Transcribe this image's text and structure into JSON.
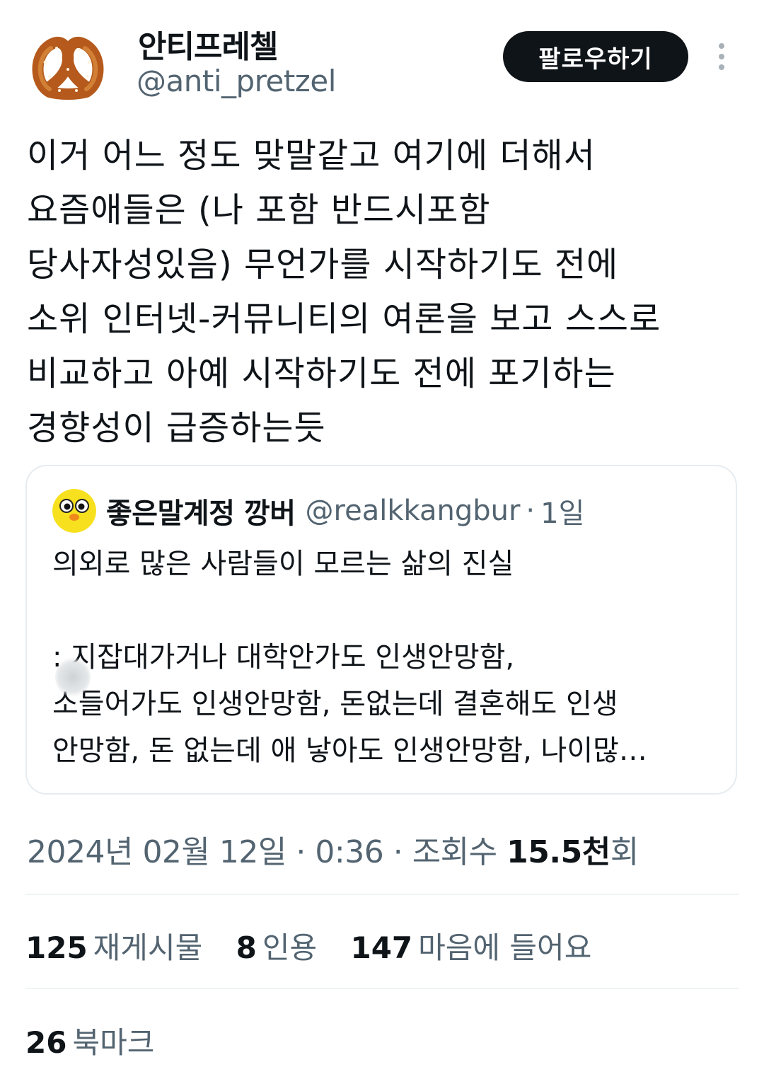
{
  "author": {
    "display_name": "안티프레첼",
    "handle": "@anti_pretzel",
    "avatar_icon": "pretzel-avatar-icon"
  },
  "actions": {
    "follow_label": "팔로우하기",
    "more_icon": "more-vertical-icon"
  },
  "tweet": {
    "lines": [
      "이거 어느 정도 맞말같고 여기에 더해서",
      "요즘애들은 (나 포함 반드시포함",
      "당사자성있음) 무언가를 시작하기도 전에",
      "소위 인터넷-커뮤니티의 여론을 보고 스스로",
      "비교하고 아예 시작하기도 전에 포기하는",
      "경향성이 급증하는듯"
    ]
  },
  "quote": {
    "display_name": "좋은말계정 깡버",
    "handle": "@realkkangbur",
    "separator": "·",
    "time": "1일",
    "avatar_icon": "chick-face-avatar-icon",
    "lines": [
      "의외로 많은 사람들이 모르는 삶의 진실",
      "",
      ": 지잡대가거나 대학안가도 인생안망함,",
      "   소들어가도 인생안망함, 돈없는데 결혼해도 인생",
      "안망함, 돈 없는데 애 낳아도 인생안망함, 나이많…"
    ]
  },
  "meta": {
    "date": "2024년 02월 12일",
    "sep1": "·",
    "time": "0:36",
    "sep2": "·",
    "views_label": "조회수",
    "views_value": "15.5",
    "views_unit": "천",
    "views_suffix": "회"
  },
  "stats": {
    "reposts_count": "125",
    "reposts_label": "재게시물",
    "quotes_count": "8",
    "quotes_label": "인용",
    "likes_count": "147",
    "likes_label": "마음에 들어요",
    "bookmarks_count": "26",
    "bookmarks_label": "북마크"
  },
  "colors": {
    "text_primary": "#0f1419",
    "text_secondary": "#536471",
    "button_bg": "#0f1419",
    "border": "#e6ecf0"
  }
}
